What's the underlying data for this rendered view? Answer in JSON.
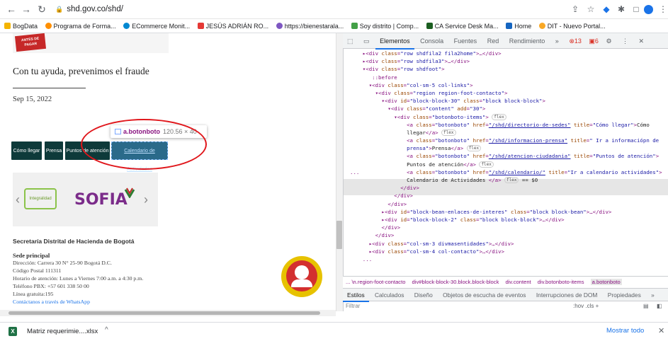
{
  "browser": {
    "url": "shd.gov.co/shd/",
    "bookmarks": [
      "BogData",
      "Programa de Forma...",
      "ECommerce Monit...",
      "JESÚS ADRIÁN RO...",
      "https://bienestarala...",
      "Soy distrito | Comp...",
      "CA Service Desk Ma...",
      "Home",
      "DIT - Nuevo Portal..."
    ]
  },
  "page": {
    "banner_badge": "ANTES DE PAGAR",
    "headline": "Con tu ayuda, prevenimos el fraude",
    "date": "Sep 15, 2022",
    "buttons": [
      "Cómo llegar",
      "Prensa",
      "Puntos de atención",
      "Calendario de Actividades"
    ],
    "tooltip": {
      "name": "a.botonboto",
      "size": "120.56 × 40"
    },
    "logos": {
      "left": "Integralidad",
      "right": "SOFIA"
    },
    "footer": {
      "title": "Secretaría Distrital de Hacienda de Bogotá",
      "sede": "Sede principal",
      "lines": [
        "Dirección: Carrera 30 N° 25-90 Bogotá D.C.",
        "Código Postal 111311",
        "Horario de atención: Lunes a Viernes 7:00 a.m. a 4:30 p.m.",
        "Teléfono PBX: +57 601 338 50 00",
        "Línea gratuita:195"
      ],
      "whatsapp": "Contáctanos a través de WhatsApp"
    }
  },
  "devtools": {
    "tabs": [
      "Elementos",
      "Consola",
      "Fuentes",
      "Red",
      "Rendimiento",
      "»"
    ],
    "errors": "13",
    "warnings": "6",
    "breadcrumbs": [
      "... \\n.region-foot-contacto",
      "div#block-block-30.block.block-block",
      "div.content",
      "div.botonboto-items",
      "a.botonboto"
    ],
    "style_tabs": [
      "Estilos",
      "Calculados",
      "Diseño",
      "Objetos de escucha de eventos",
      "Interrupciones de DOM",
      "Propiedades",
      "»"
    ],
    "filter_placeholder": "Filtrar",
    "filter_tools": ":hov  .cls  +"
  },
  "download": {
    "file": "Matriz requerimie....xlsx",
    "show_all": "Mostrar todo"
  }
}
